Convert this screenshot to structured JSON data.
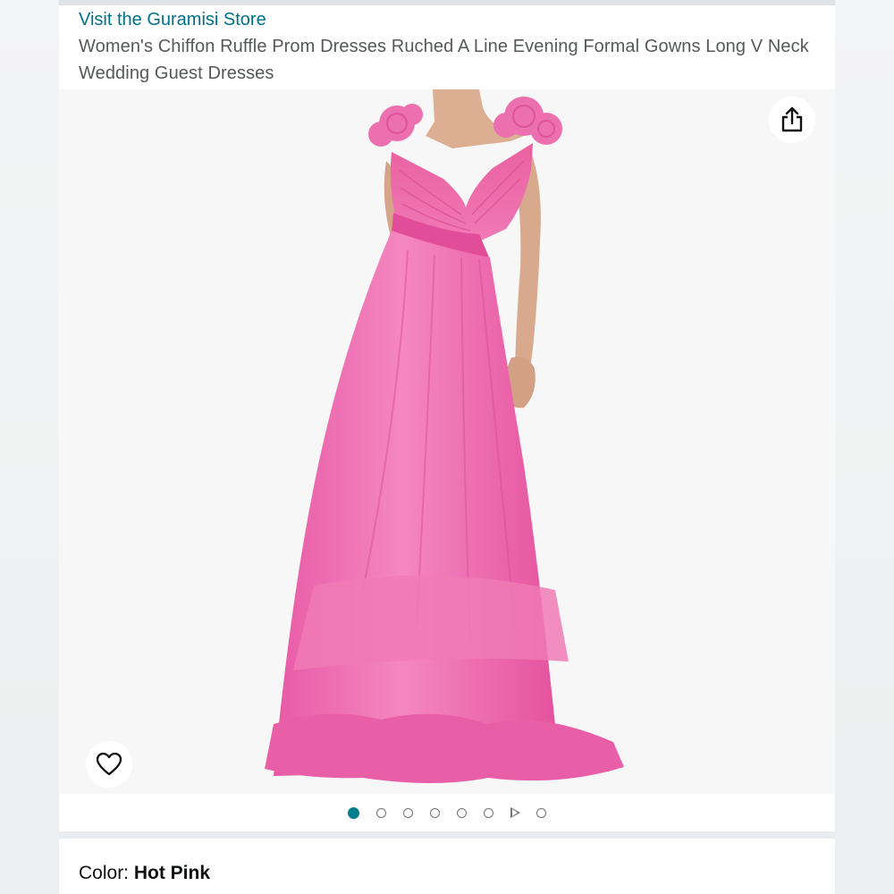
{
  "store": {
    "link_text": "Visit the Guramisi Store"
  },
  "product": {
    "title": "Women's Chiffon Ruffle Prom Dresses Ruched A Line Evening Formal Gowns Long V Neck Wedding Guest Dresses"
  },
  "image": {
    "share_icon": "share-icon",
    "favorite_icon": "heart-icon",
    "dress_color": "#f27bb8"
  },
  "carousel": {
    "active_index": 0,
    "items": [
      "image",
      "image",
      "image",
      "image",
      "image",
      "image",
      "video",
      "image"
    ],
    "active_color": "#037f8c"
  },
  "variation": {
    "color_label": "Color: ",
    "color_value": "Hot Pink"
  }
}
